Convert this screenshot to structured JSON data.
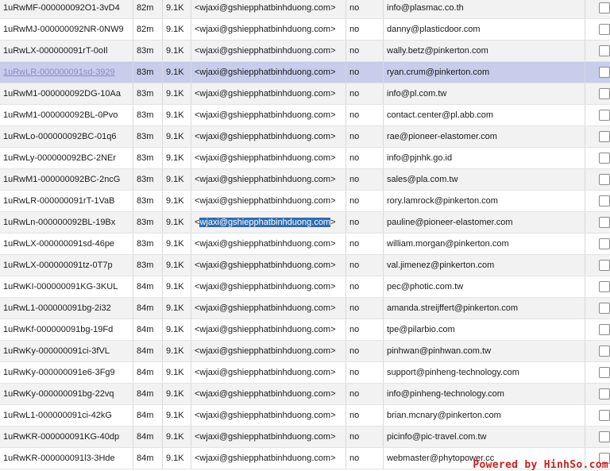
{
  "watermark": "Powered by HinhSo.com",
  "rows": [
    {
      "id": "1uRwMF-000000092O1-3vD4",
      "age": "82m",
      "size": "9.1K",
      "from": "<wjaxi@gshiepphatbinhduong.com>",
      "frozen": "no",
      "recipient": "info@plasmac.co.th"
    },
    {
      "id": "1uRwMJ-000000092NR-0NW9",
      "age": "82m",
      "size": "9.1K",
      "from": "<wjaxi@gshiepphatbinhduong.com>",
      "frozen": "no",
      "recipient": "danny@plasticdoor.com"
    },
    {
      "id": "1uRwLX-000000091rT-0oIl",
      "age": "83m",
      "size": "9.1K",
      "from": "<wjaxi@gshiepphatbinhduong.com>",
      "frozen": "no",
      "recipient": "wally.betz@pinkerton.com"
    },
    {
      "id": "1uRwLR-000000091sd-3929",
      "age": "83m",
      "size": "9.1K",
      "from": "<wjaxi@gshiepphatbinhduong.com>",
      "frozen": "no",
      "recipient": "ryan.crum@pinkerton.com"
    },
    {
      "id": "1uRwM1-000000092DG-10Aa",
      "age": "83m",
      "size": "9.1K",
      "from": "<wjaxi@gshiepphatbinhduong.com>",
      "frozen": "no",
      "recipient": "info@pl.com.tw"
    },
    {
      "id": "1uRwM1-000000092BL-0Pvo",
      "age": "83m",
      "size": "9.1K",
      "from": "<wjaxi@gshiepphatbinhduong.com>",
      "frozen": "no",
      "recipient": "contact.center@pl.abb.com"
    },
    {
      "id": "1uRwLo-000000092BC-01q6",
      "age": "83m",
      "size": "9.1K",
      "from": "<wjaxi@gshiepphatbinhduong.com>",
      "frozen": "no",
      "recipient": "rae@pioneer-elastomer.com"
    },
    {
      "id": "1uRwLy-000000092BC-2NEr",
      "age": "83m",
      "size": "9.1K",
      "from": "<wjaxi@gshiepphatbinhduong.com>",
      "frozen": "no",
      "recipient": "info@pjnhk.go.id"
    },
    {
      "id": "1uRwM1-000000092BC-2ncG",
      "age": "83m",
      "size": "9.1K",
      "from": "<wjaxi@gshiepphatbinhduong.com>",
      "frozen": "no",
      "recipient": "sales@pla.com.tw"
    },
    {
      "id": "1uRwLR-000000091rT-1VaB",
      "age": "83m",
      "size": "9.1K",
      "from": "<wjaxi@gshiepphatbinhduong.com>",
      "frozen": "no",
      "recipient": "rory.lamrock@pinkerton.com"
    },
    {
      "id": "1uRwLn-000000092BL-19Bx",
      "age": "83m",
      "size": "9.1K",
      "from_pre": "<",
      "from_sel": "wjaxi@gshiepphatbinhduong.com",
      "from_post": ">",
      "frozen": "no",
      "recipient": "pauline@pioneer-elastomer.com"
    },
    {
      "id": "1uRwLX-000000091sd-46pe",
      "age": "83m",
      "size": "9.1K",
      "from": "<wjaxi@gshiepphatbinhduong.com>",
      "frozen": "no",
      "recipient": "william.morgan@pinkerton.com"
    },
    {
      "id": "1uRwLX-000000091tz-0T7p",
      "age": "83m",
      "size": "9.1K",
      "from": "<wjaxi@gshiepphatbinhduong.com>",
      "frozen": "no",
      "recipient": "val.jimenez@pinkerton.com"
    },
    {
      "id": "1uRwKI-000000091KG-3KUL",
      "age": "84m",
      "size": "9.1K",
      "from": "<wjaxi@gshiepphatbinhduong.com>",
      "frozen": "no",
      "recipient": "pec@photic.com.tw"
    },
    {
      "id": "1uRwL1-000000091bg-2i32",
      "age": "84m",
      "size": "9.1K",
      "from": "<wjaxi@gshiepphatbinhduong.com>",
      "frozen": "no",
      "recipient": "amanda.streijffert@pinkerton.com"
    },
    {
      "id": "1uRwKf-000000091bg-19Fd",
      "age": "84m",
      "size": "9.1K",
      "from": "<wjaxi@gshiepphatbinhduong.com>",
      "frozen": "no",
      "recipient": "tpe@pilarbio.com"
    },
    {
      "id": "1uRwKy-000000091ci-3fVL",
      "age": "84m",
      "size": "9.1K",
      "from": "<wjaxi@gshiepphatbinhduong.com>",
      "frozen": "no",
      "recipient": "pinhwan@pinhwan.com.tw"
    },
    {
      "id": "1uRwKy-000000091e6-3Fg9",
      "age": "84m",
      "size": "9.1K",
      "from": "<wjaxi@gshiepphatbinhduong.com>",
      "frozen": "no",
      "recipient": "support@pinheng-technology.com"
    },
    {
      "id": "1uRwKy-000000091bg-22vq",
      "age": "84m",
      "size": "9.1K",
      "from": "<wjaxi@gshiepphatbinhduong.com>",
      "frozen": "no",
      "recipient": "info@pinheng-technology.com"
    },
    {
      "id": "1uRwL1-000000091ci-42kG",
      "age": "84m",
      "size": "9.1K",
      "from": "<wjaxi@gshiepphatbinhduong.com>",
      "frozen": "no",
      "recipient": "brian.mcnary@pinkerton.com"
    },
    {
      "id": "1uRwKR-000000091KG-40dp",
      "age": "84m",
      "size": "9.1K",
      "from": "<wjaxi@gshiepphatbinhduong.com>",
      "frozen": "no",
      "recipient": "picinfo@pic-travel.com.tw"
    },
    {
      "id": "1uRwKR-000000091l3-3Hde",
      "age": "84m",
      "size": "9.1K",
      "from": "<wjaxi@gshiepphatbinhduong.com>",
      "frozen": "no",
      "recipient": "webmaster@phytopower.cc"
    }
  ]
}
